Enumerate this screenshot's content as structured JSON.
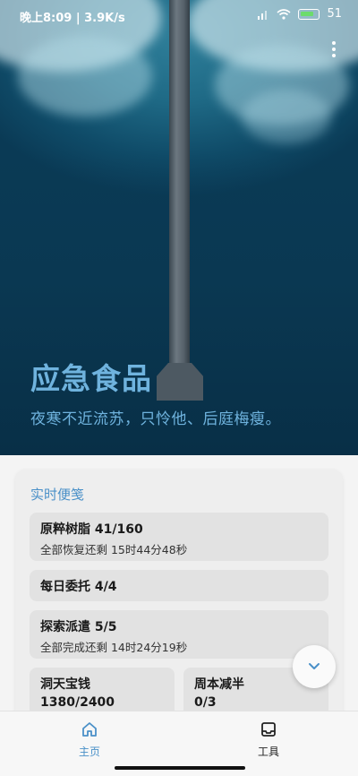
{
  "status_bar": {
    "time": "晚上8:09 | 3.9K/s",
    "battery": "51"
  },
  "hero": {
    "title": "应急食品",
    "subtitle": "夜寒不近流苏，只怜他、后庭梅瘦。"
  },
  "panel": {
    "title": "实时便笺",
    "items": [
      {
        "label": "原粹树脂 41/160",
        "detail": "全部恢复还剩 15时44分48秒"
      },
      {
        "label": "每日委托 4/4"
      },
      {
        "label": "探索派遣 5/5",
        "detail": "全部完成还剩 14时24分19秒"
      },
      {
        "label": "洞天宝钱",
        "value": "1380/2400"
      },
      {
        "label": "周本减半",
        "value": "0/3"
      }
    ]
  },
  "bottom_nav": {
    "items": [
      {
        "label": "主页",
        "icon": "home-icon",
        "active": true
      },
      {
        "label": "工具",
        "icon": "inbox-tray-icon",
        "active": false
      }
    ]
  },
  "colors": {
    "accent": "#4a90c8",
    "hero_text": "#6fb3de"
  }
}
